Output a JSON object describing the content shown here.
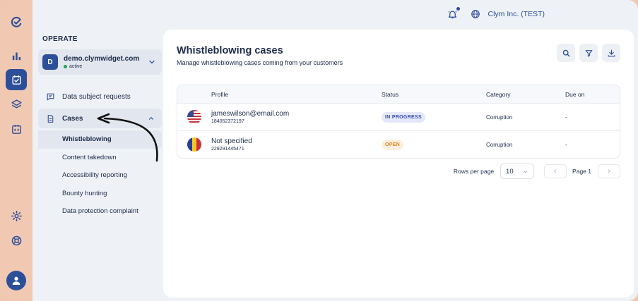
{
  "rail": {
    "icons": [
      "logo-icon",
      "analytics-icon",
      "cases-icon",
      "layers-icon",
      "widget-code-icon",
      "settings-icon",
      "support-icon",
      "user-avatar-icon"
    ]
  },
  "topbar": {
    "company": "Clym Inc. (TEST)"
  },
  "sidebar": {
    "section_label": "OPERATE",
    "account": {
      "badge": "D",
      "domain": "demo.clymwidget.com",
      "status": "active"
    },
    "items": [
      {
        "label": "Data subject requests"
      },
      {
        "label": "Cases"
      }
    ],
    "sub_items": [
      {
        "label": "Whistleblowing"
      },
      {
        "label": "Content takedown"
      },
      {
        "label": "Accessibility reporting"
      },
      {
        "label": "Bounty hunting"
      },
      {
        "label": "Data protection complaint"
      }
    ]
  },
  "main": {
    "title": "Whistleblowing cases",
    "subtitle": "Manage whistleblowing cases coming from your customers",
    "table": {
      "headers": {
        "profile": "Profile",
        "status": "Status",
        "category": "Category",
        "due": "Due on"
      },
      "rows": [
        {
          "name": "jameswilson@email.com",
          "id": "184052372197",
          "status": "IN PROGRESS",
          "category": "Corruption",
          "due": "-"
        },
        {
          "name": "Not specified",
          "id": "229291445471",
          "status": "OPEN",
          "category": "Corruption",
          "due": "-"
        }
      ]
    },
    "pager": {
      "rows_label": "Rows per page",
      "rows_value": "10",
      "page_label": "Page 1"
    }
  },
  "colors": {
    "brand": "#2d4f9a",
    "rail": "#f1c9b3",
    "badge_progress": "#3b4fb3",
    "badge_open": "#d88a1e"
  }
}
